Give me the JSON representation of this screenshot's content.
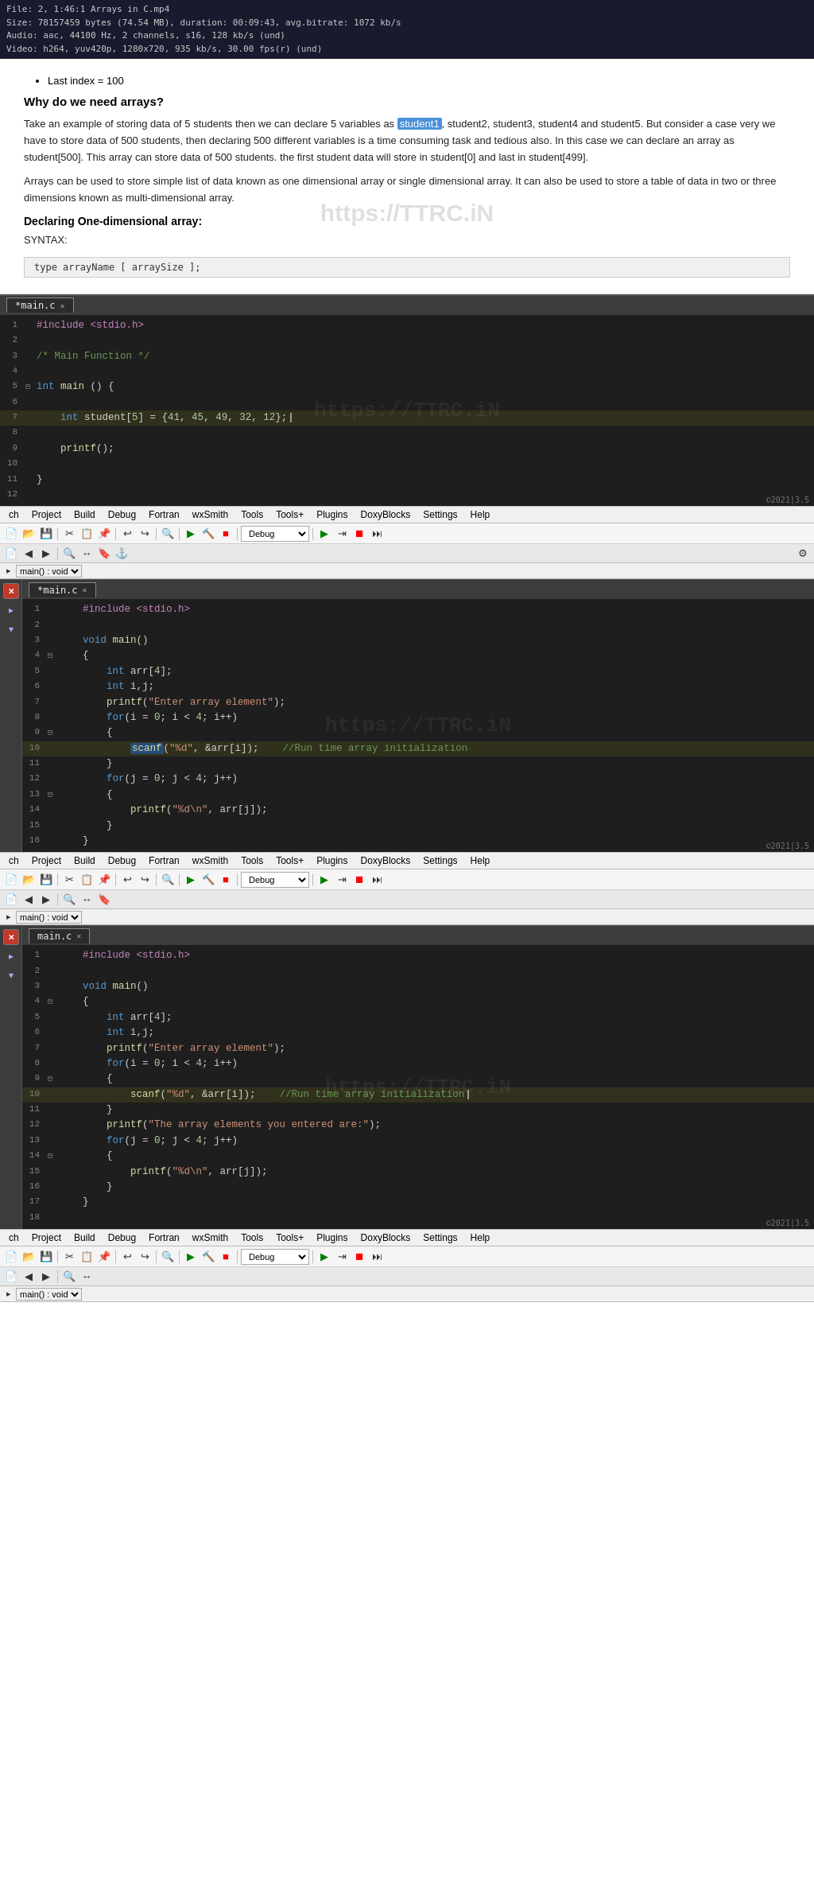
{
  "videoInfo": {
    "line1": "File: 2, 1:46:1 Arrays in C.mp4",
    "line2": "Size: 78157459 bytes (74.54 MB), duration: 00:09:43, avg.bitrate: 1072 kb/s",
    "line3": "Audio: aac, 44100 Hz, 2 channels, s16, 128 kb/s (und)",
    "line4": "Video: h264, yuv420p, 1280x720, 935 kb/s, 30.00 fps(r) (und)"
  },
  "article": {
    "bullet1": "Last index = 100",
    "heading1": "Why do we need arrays?",
    "para1a": "Take an example of storing data of 5 students then we can declare 5 variables as ",
    "highlight": "student1",
    "para1b": ", student2, student3, student4 and student5. But consider a case very we have to store data of 500 students, then declaring 500 different variables is a time consuming task and tedious also. In this case we can declare an array as student[500]. This array can store data of 500 students. the first student data will store in student[0] and last in student[499].",
    "para2": "Arrays can be used to store simple list of data known as one dimensional array or single dimensional array. It can also be used to store a table of data in two or three dimensions known as multi-dimensional array.",
    "heading2": "Declaring One-dimensional array:",
    "syntaxLabel": "SYNTAX:",
    "syntaxCode": "type arrayName [ arraySize ];",
    "watermark": "https://TTRC.iN"
  },
  "editor1": {
    "tab": "*main.c",
    "lines": [
      {
        "num": 1,
        "content": "#include <stdio.h>",
        "type": "preprocessor"
      },
      {
        "num": 2,
        "content": "",
        "type": "normal"
      },
      {
        "num": 3,
        "content": "/* Main Function */",
        "type": "comment"
      },
      {
        "num": 4,
        "content": "",
        "type": "normal"
      },
      {
        "num": 5,
        "content": "int main () {",
        "type": "keyword-line",
        "fold": true
      },
      {
        "num": 6,
        "content": "",
        "type": "normal"
      },
      {
        "num": 7,
        "content": "    int student[5] = {41, 45, 49, 32, 12};",
        "type": "normal"
      },
      {
        "num": 8,
        "content": "",
        "type": "normal"
      },
      {
        "num": 9,
        "content": "    printf();",
        "type": "normal"
      },
      {
        "num": 10,
        "content": "",
        "type": "normal"
      },
      {
        "num": 11,
        "content": "}",
        "type": "normal"
      },
      {
        "num": 12,
        "content": "",
        "type": "normal"
      }
    ],
    "watermark": "https://TTRC.iN",
    "timestamp": "©2021|3.5"
  },
  "menuBar1": {
    "items": [
      "ch",
      "Project",
      "Build",
      "Debug",
      "Fortran",
      "wxSmith",
      "Tools",
      "Tools+",
      "Plugins",
      "DoxyBlocks",
      "Settings",
      "Help"
    ]
  },
  "toolbar1": {
    "debugLabel": "Debug",
    "timestamp": "©2021|3.5"
  },
  "funcBar1": {
    "label": "main() : void"
  },
  "editor2": {
    "tab": "*main.c",
    "lines": [
      {
        "num": 1,
        "content": "    #include <stdio.h>",
        "type": "preprocessor"
      },
      {
        "num": 2,
        "content": "",
        "type": "normal"
      },
      {
        "num": 3,
        "content": "    void main()",
        "type": "keyword-line"
      },
      {
        "num": 4,
        "content": "    {",
        "type": "fold"
      },
      {
        "num": 5,
        "content": "        int arr[4];",
        "type": "normal"
      },
      {
        "num": 6,
        "content": "        int i,j;",
        "type": "normal"
      },
      {
        "num": 7,
        "content": "        printf(\"Enter array element\");",
        "type": "normal"
      },
      {
        "num": 8,
        "content": "        for(i = 0; i < 4; i++)",
        "type": "normal"
      },
      {
        "num": 9,
        "content": "        {",
        "type": "fold"
      },
      {
        "num": 10,
        "content": "            scanf(\"%d\", &arr[i]);    //Run time array initialization",
        "type": "normal",
        "highlight": "scanf"
      },
      {
        "num": 11,
        "content": "        }",
        "type": "normal"
      },
      {
        "num": 12,
        "content": "        for(j = 0; j < 4; j++)",
        "type": "normal"
      },
      {
        "num": 13,
        "content": "        {",
        "type": "fold"
      },
      {
        "num": 14,
        "content": "            printf(\"%d\\n\", arr[j]);",
        "type": "normal"
      },
      {
        "num": 15,
        "content": "        }",
        "type": "normal"
      },
      {
        "num": 16,
        "content": "    }",
        "type": "normal"
      }
    ],
    "watermark": "https://TTRC.iN",
    "timestamp": "©2021|3.5"
  },
  "menuBar2": {
    "items": [
      "ch",
      "Project",
      "Build",
      "Debug",
      "Fortran",
      "wxSmith",
      "Tools",
      "Tools+",
      "Plugins",
      "DoxyBlocks",
      "Settings",
      "Help"
    ]
  },
  "toolbar2": {
    "debugLabel": "Debug"
  },
  "funcBar2": {
    "label": "main() : void"
  },
  "editor3": {
    "tab": "main.c",
    "lines": [
      {
        "num": 1,
        "content": "    #include <stdio.h>",
        "type": "preprocessor"
      },
      {
        "num": 2,
        "content": "",
        "type": "normal"
      },
      {
        "num": 3,
        "content": "    void main()",
        "type": "keyword-line"
      },
      {
        "num": 4,
        "content": "    {",
        "type": "fold"
      },
      {
        "num": 5,
        "content": "        int arr[4];",
        "type": "normal"
      },
      {
        "num": 6,
        "content": "        int i,j;",
        "type": "normal"
      },
      {
        "num": 7,
        "content": "        printf(\"Enter array element\");",
        "type": "normal"
      },
      {
        "num": 8,
        "content": "        for(i = 0; i < 4; i++)",
        "type": "normal"
      },
      {
        "num": 9,
        "content": "        {",
        "type": "fold"
      },
      {
        "num": 10,
        "content": "            scanf(\"%d\", &arr[i]);    //Run time array initialization",
        "type": "normal"
      },
      {
        "num": 11,
        "content": "        }",
        "type": "normal"
      },
      {
        "num": 12,
        "content": "        printf(\"The array elements you entered are:\");",
        "type": "normal"
      },
      {
        "num": 13,
        "content": "        for(j = 0; j < 4; j++)",
        "type": "normal"
      },
      {
        "num": 14,
        "content": "        {",
        "type": "fold"
      },
      {
        "num": 15,
        "content": "            printf(\"%d\\n\", arr[j]);",
        "type": "normal"
      },
      {
        "num": 16,
        "content": "        }",
        "type": "normal"
      },
      {
        "num": 17,
        "content": "    }",
        "type": "normal"
      },
      {
        "num": 18,
        "content": "",
        "type": "normal"
      }
    ],
    "watermark": "https://TTRC.iN",
    "timestamp": "©2021|3.5"
  },
  "menuBar3": {
    "items": [
      "ch",
      "Project",
      "Build",
      "Debug",
      "Fortran",
      "wxSmith",
      "Tools",
      "Tools+",
      "Plugins",
      "DoxyBlocks",
      "Settings",
      "Help"
    ]
  },
  "toolbar3": {
    "debugLabel": "Debug"
  },
  "funcBar3": {
    "label": "main() : void"
  }
}
